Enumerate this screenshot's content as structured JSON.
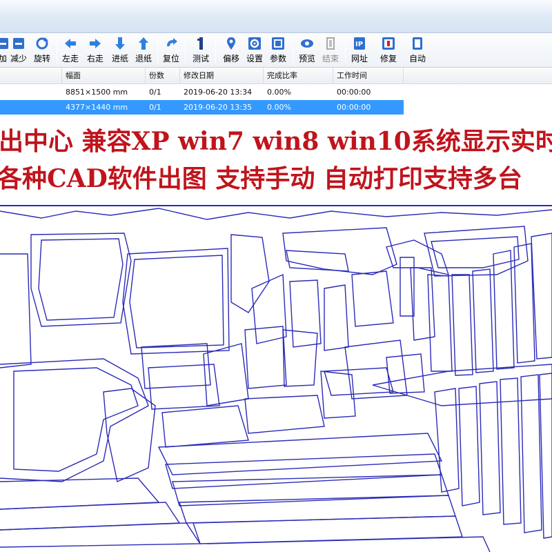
{
  "toolbar": {
    "buttons": [
      {
        "id": "add",
        "label": "加"
      },
      {
        "id": "reduce",
        "label": "减少"
      },
      {
        "id": "rotate",
        "label": "旋转"
      },
      {
        "id": "left",
        "label": "左走"
      },
      {
        "id": "right",
        "label": "右走"
      },
      {
        "id": "feed",
        "label": "进纸"
      },
      {
        "id": "back",
        "label": "退纸"
      },
      {
        "id": "reset",
        "label": "复位"
      },
      {
        "id": "test",
        "label": "测试"
      },
      {
        "id": "offset",
        "label": "偏移"
      },
      {
        "id": "settings",
        "label": "设置"
      },
      {
        "id": "params",
        "label": "参数"
      },
      {
        "id": "preview",
        "label": "预览"
      },
      {
        "id": "end",
        "label": "结束"
      },
      {
        "id": "ip",
        "label": "网址"
      },
      {
        "id": "repair",
        "label": "修复"
      },
      {
        "id": "auto",
        "label": "自动"
      }
    ]
  },
  "grid": {
    "columns": [
      "幅面",
      "份数",
      "修改日期",
      "完成比率",
      "工作时间"
    ],
    "rows": [
      {
        "size": "8851×1500 mm",
        "copies": "0/1",
        "date": "2019-06-20 13:34",
        "ratio": "0.00%",
        "time": "00:00:00",
        "selected": false
      },
      {
        "size": "4377×1440 mm",
        "copies": "0/1",
        "date": "2019-06-20 13:35",
        "ratio": "0.00%",
        "time": "00:00:00",
        "selected": true
      }
    ]
  },
  "banner": {
    "line1": "出中心 兼容XP win7 win8 win10系统显示实时",
    "line2": "各种CAD软件出图 支持手动 自动打印支持多台"
  },
  "colors": {
    "accent_blue": "#3399ff",
    "banner_red": "#c0141c",
    "pattern_stroke": "#2a2ab8"
  }
}
